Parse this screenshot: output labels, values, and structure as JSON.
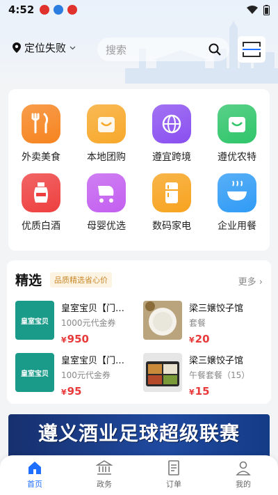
{
  "status_bar": {
    "time": "4:52"
  },
  "header": {
    "location_label": "定位失败",
    "search_placeholder": "搜索"
  },
  "categories": [
    {
      "label": "外卖美食",
      "icon": "fork-knife-icon",
      "color": "#f6841f"
    },
    {
      "label": "本地团购",
      "icon": "shopping-bag-icon",
      "color": "#f7a82a"
    },
    {
      "label": "遵宜跨境",
      "icon": "globe-icon",
      "color": "#8a4ff0"
    },
    {
      "label": "遵优农特",
      "icon": "basket-icon",
      "color": "#2fc56a"
    },
    {
      "label": "优质白酒",
      "icon": "liquor-bottle-icon",
      "color": "#ee3f3f"
    },
    {
      "label": "母婴优选",
      "icon": "stroller-icon",
      "color": "#c35ff0"
    },
    {
      "label": "数码家电",
      "icon": "fridge-icon",
      "color": "#f7a31e"
    },
    {
      "label": "企业用餐",
      "icon": "bowl-icon",
      "color": "#2f9bf5"
    }
  ],
  "featured": {
    "title": "精选",
    "tag": "品质精选省心价",
    "more_label": "更多",
    "items": [
      {
        "name": "皇室宝贝【门…",
        "sub": "1000元代金券",
        "price": "950",
        "image": "brand-logo"
      },
      {
        "name": "梁三嬢饺子馆",
        "sub": "套餐",
        "price": "20",
        "image": "dumplings-photo"
      },
      {
        "name": "皇室宝贝【门…",
        "sub": "100元代金券",
        "price": "95",
        "image": "brand-logo"
      },
      {
        "name": "梁三嬢饺子馆",
        "sub": "午餐套餐（15）",
        "price": "15",
        "image": "lunch-box-photo"
      }
    ],
    "currency": "¥",
    "brand_logo_text": "皇室宝贝"
  },
  "banner": {
    "text": "遵义酒业足球超级联赛"
  },
  "tabs": [
    {
      "label": "首页",
      "icon": "home-icon",
      "active": true
    },
    {
      "label": "政务",
      "icon": "government-building-icon",
      "active": false
    },
    {
      "label": "订单",
      "icon": "order-list-icon",
      "active": false
    },
    {
      "label": "我的",
      "icon": "user-icon",
      "active": false
    }
  ],
  "colors": {
    "accent": "#1e6fff",
    "price": "#e83a3a",
    "tag_text": "#c9892c",
    "brand_teal": "#1a9a88"
  }
}
